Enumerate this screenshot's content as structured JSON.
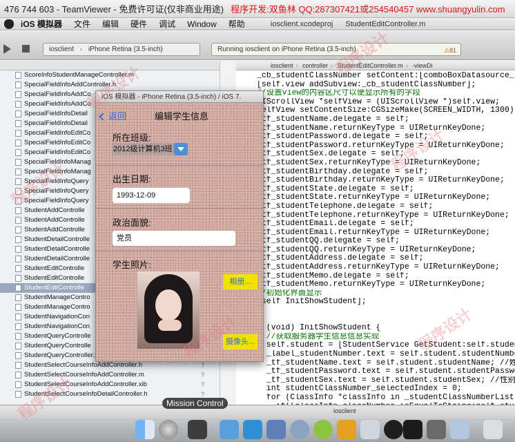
{
  "teamviewer": {
    "title": "476 744 603 - TeamViewer - 免费许可证(仅非商业用途)",
    "ad": "程序开发:双鱼林 QQ:287307421或254540457 www.shuangyulin.com"
  },
  "menubar": {
    "app": "iOS 模拟器",
    "items": [
      "文件",
      "编辑",
      "硬件",
      "调试",
      "Window",
      "帮助"
    ],
    "project_file": "iosclient.xcodeproj",
    "editor_file": "StudentEditController.m"
  },
  "toolbar": {
    "scheme_target": "iosclient",
    "scheme_device": "iPhone Retina (3.5-inch)",
    "status_text": "Running iosclient on iPhone Retina (3.5-inch)",
    "warning_count": "81"
  },
  "jumpbar": [
    "iosclient",
    "controller",
    "StudentEditController.m",
    "-viewDi"
  ],
  "files": [
    {
      "name": "ScoreInfoStudentManageController.m",
      "q": ""
    },
    {
      "name": "SpecialFieldInfoAddController.h",
      "q": ""
    },
    {
      "name": "SpecialFieldInfoAddCo",
      "q": ""
    },
    {
      "name": "SpecialFieldInfoAddCo",
      "q": ""
    },
    {
      "name": "SpecialFieldInfoDetail",
      "q": ""
    },
    {
      "name": "SpecialFieldInfoDetail",
      "q": ""
    },
    {
      "name": "SpecialFieldInfoEditCo",
      "q": ""
    },
    {
      "name": "SpecialFieldInfoEditCo",
      "q": ""
    },
    {
      "name": "SpecialFieldInfoEditCo",
      "q": ""
    },
    {
      "name": "SpecialFieldInfoManag",
      "q": ""
    },
    {
      "name": "SpecialFieldInfoManag",
      "q": ""
    },
    {
      "name": "SpecialFieldInfoQuery",
      "q": ""
    },
    {
      "name": "SpecialFieldInfoQuery",
      "q": ""
    },
    {
      "name": "SpecialFieldInfoQuery",
      "q": ""
    },
    {
      "name": "StudentAddControlle",
      "q": ""
    },
    {
      "name": "StudentAddControlle",
      "q": ""
    },
    {
      "name": "StudentAddControlle",
      "q": ""
    },
    {
      "name": "StudentDetailControlle",
      "q": ""
    },
    {
      "name": "StudentDetailControlle",
      "q": ""
    },
    {
      "name": "StudentDetailControlle",
      "q": ""
    },
    {
      "name": "StudentEditControlle",
      "q": ""
    },
    {
      "name": "StudentEditControlle",
      "q": ""
    },
    {
      "name": "StudentEditControlle",
      "q": ""
    },
    {
      "name": "StudentManageContro",
      "q": ""
    },
    {
      "name": "StudentManageContro",
      "q": ""
    },
    {
      "name": "StudentNavigationCon",
      "q": ""
    },
    {
      "name": "StudentNavigationCon",
      "q": ""
    },
    {
      "name": "StudentQueryControlle",
      "q": ""
    },
    {
      "name": "StudentQueryControlle",
      "q": ""
    },
    {
      "name": "StudentQueryController.xib",
      "q": "?"
    },
    {
      "name": "StudentSelectCourseInfoAddController.h",
      "q": "?"
    },
    {
      "name": "StudentSelectCourseInfoAddController.m",
      "q": "?"
    },
    {
      "name": "StudentSelectCourseInfoAddController.xib",
      "q": "?"
    },
    {
      "name": "StudentSelectCourseInfoDetailController.h",
      "q": "?"
    }
  ],
  "simulator": {
    "window_title": "iOS 模拟器 - iPhone Retina (3.5-inch) / iOS 7.",
    "back_label": "返回",
    "nav_title": "编辑学生信息",
    "class_label": "所在班级:",
    "class_value": "2012级计算机3班",
    "birth_label": "出生日期:",
    "birth_value": "1993-12-09",
    "politics_label": "政治面貌:",
    "politics_value": "党员",
    "photo_label": "学生照片:",
    "album_button": "相册...",
    "camera_button": "摄像头..."
  },
  "code_lines": [
    "_cb_studentClassNumber setContent:[comboBoxDatasource_st",
    "[self.view addSubview:_cb_studentClassNumber];",
    "//设置view的内容区尺寸以便显示所有的字段",
    "UIScrollView *selfView = (UIScrollView *)self.view;",
    "selfView setContentSize:CGSizeMake(SCREEN_WIDTH, 1300)];",
    "_tf_studentName.delegate = self;",
    "_tf_studentName.returnKeyType = UIReturnKeyDone;",
    "_tf_studentPassword.delegate = self;",
    "_tf_studentPassword.returnKeyType = UIReturnKeyDone;",
    "_tf_studentSex.delegate = self;",
    "_tf_studentSex.returnKeyType = UIReturnKeyDone;",
    "_tf_studentBirthday.delegate = self;",
    "_tf_studentBirthday.returnKeyType = UIReturnKeyDone;",
    "_tf_studentState.delegate = self;",
    "_tf_studentState.returnKeyType = UIReturnKeyDone;",
    "_tf_studentTelephone.delegate = self;",
    "_tf_studentTelephone.returnKeyType = UIReturnKeyDone;",
    "_tf_studentEmail.delegate = self;",
    "_tf_studentEmail.returnKeyType = UIReturnKeyDone;",
    "_tf_studentQQ.delegate = self;",
    "_tf_studentQQ.returnKeyType = UIReturnKeyDone;",
    "_tf_studentAddress.delegate = self;",
    "_tf_studentAddress.returnKeyType = UIReturnKeyDone;",
    "_tf_studentMemo.delegate = self;",
    "_tf_studentMemo.returnKeyType = UIReturnKeyDone;",
    "//初始化界面显示",
    "[self InitShowStudent];",
    "",
    "",
    "- (void) InitShowStudent {",
    "  //获取服务器学生信息信息实现",
    "  self.student = [StudentService GetStudent:self.studentNum",
    "  _label_studentNumber.text = self.student.studentNumber;",
    "  _tf_studentName.text = self.student.studentName; //姓名",
    "  _tf_studentPassword.text = self.student.studentPassword;",
    "  _tf_studentSex.text = self.student.studentSex; //性别",
    "  int studentClassNumber_selectedIndex = 0;",
    "  for (ClassInfo *classInfo in _studentClassNumberList) {",
    "    if([classInfo.classNumber isEqualToString:self.studen"
  ],
  "bottom": {
    "target": "iosclient"
  },
  "tooltip": "Mission Control",
  "watermark": "程序设计"
}
